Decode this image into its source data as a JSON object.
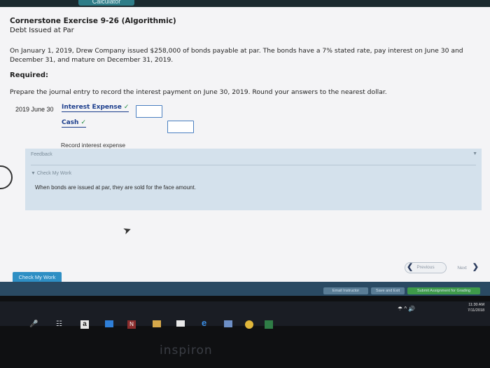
{
  "top": {
    "tab_label": "Calculator"
  },
  "header": {
    "title": "Cornerstone Exercise 9-26 (Algorithmic)",
    "subtitle": "Debt Issued at Par"
  },
  "problem": {
    "text": "On January 1, 2019, Drew Company issued $258,000 of bonds payable at par. The bonds have a 7% stated rate, pay interest on June 30 and December 31, and mature on December 31, 2019.",
    "required_label": "Required:",
    "instruction": "Prepare the journal entry to record the interest payment on June 30, 2019. Round your answers to the nearest dollar."
  },
  "journal": {
    "date": "2019 June 30",
    "debit_account": "Interest Expense",
    "credit_account": "Cash",
    "check_mark": "✓",
    "debit_value": "",
    "credit_value": "",
    "memo": "Record interest expense"
  },
  "feedback": {
    "label": "Feedback",
    "caret": "▼",
    "check_label": "▼ Check My Work",
    "message": "When bonds are issued at par, they are sold for the face amount."
  },
  "nav": {
    "previous": "Previous",
    "next": "Next",
    "prev_chev": "❮",
    "next_chev": "❯"
  },
  "actions": {
    "check_my_work": "Check My Work",
    "email_instructor": "Email Instructor",
    "save_and_exit": "Save and Exit",
    "submit": "Submit Assignment for Grading"
  },
  "taskbar": {
    "time": "11:30 AM",
    "date": "7/11/2018",
    "icons": [
      "mic-icon",
      "task-view-icon",
      "amazon-icon",
      "store-icon",
      "onenote-icon",
      "briefcase-icon",
      "mail-icon",
      "edge-icon",
      "photos-icon",
      "chrome-icon",
      "excel-icon"
    ]
  },
  "device": {
    "brand": "inspiron"
  },
  "colors": {
    "link_blue": "#1b3d8c",
    "check_green": "#1a8a3a",
    "feedback_bg": "#d4e1ec",
    "button_blue": "#2e8fc4",
    "bottom_bar": "#2a4a63",
    "taskbar": "#1a1d24"
  }
}
